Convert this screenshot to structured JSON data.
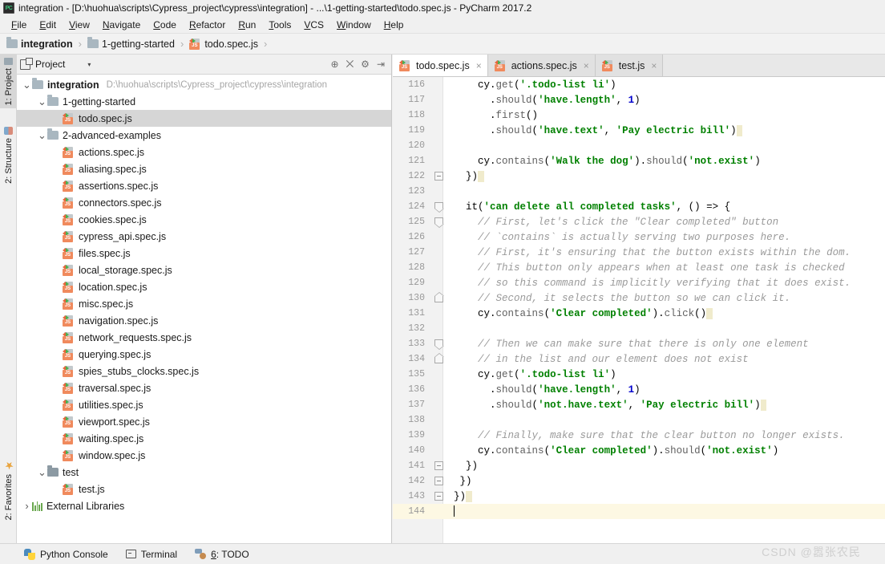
{
  "window": {
    "title": "integration - [D:\\huohua\\scripts\\Cypress_project\\cypress\\integration] - ...\\1-getting-started\\todo.spec.js - PyCharm 2017.2",
    "app_logo": "PC"
  },
  "menubar": {
    "items": [
      {
        "label": "File"
      },
      {
        "label": "Edit"
      },
      {
        "label": "View"
      },
      {
        "label": "Navigate"
      },
      {
        "label": "Code"
      },
      {
        "label": "Refactor"
      },
      {
        "label": "Run"
      },
      {
        "label": "Tools"
      },
      {
        "label": "VCS"
      },
      {
        "label": "Window"
      },
      {
        "label": "Help"
      }
    ]
  },
  "breadcrumb": {
    "items": [
      {
        "label": "integration",
        "icon": "folder-icon"
      },
      {
        "label": "1-getting-started",
        "icon": "folder-icon"
      },
      {
        "label": "todo.spec.js",
        "icon": "js-test-file-icon"
      }
    ],
    "separator": "›"
  },
  "left_strip": {
    "tabs": [
      {
        "label": "1: Project",
        "selected": true,
        "icon": "project-icon"
      },
      {
        "label": "2: Structure",
        "selected": false,
        "icon": "structure-icon"
      },
      {
        "label": "2: Favorites",
        "selected": false,
        "icon": "star-icon"
      }
    ]
  },
  "project_panel": {
    "header": {
      "title": "Project",
      "dropdown_caret": "▾",
      "tools": [
        {
          "name": "locate-icon",
          "glyph": "⊕"
        },
        {
          "name": "expand-collapse-icon",
          "glyph": "⨉"
        },
        {
          "name": "settings-gear-icon",
          "glyph": "⚙"
        },
        {
          "name": "hide-panel-icon",
          "glyph": "⇥"
        }
      ]
    },
    "tree": [
      {
        "label": "integration",
        "path": "D:\\huohua\\scripts\\Cypress_project\\cypress\\integration",
        "indent": 0,
        "twisty": "⌄",
        "icon": "folder-icon",
        "bold": true,
        "selected": false
      },
      {
        "label": "1-getting-started",
        "path": "",
        "indent": 1,
        "twisty": "⌄",
        "icon": "folder-icon",
        "bold": false,
        "selected": false
      },
      {
        "label": "todo.spec.js",
        "path": "",
        "indent": 2,
        "twisty": "",
        "icon": "js-test-file-icon",
        "bold": false,
        "selected": true
      },
      {
        "label": "2-advanced-examples",
        "path": "",
        "indent": 1,
        "twisty": "⌄",
        "icon": "folder-icon",
        "bold": false,
        "selected": false
      },
      {
        "label": "actions.spec.js",
        "path": "",
        "indent": 2,
        "twisty": "",
        "icon": "js-test-file-icon",
        "bold": false,
        "selected": false
      },
      {
        "label": "aliasing.spec.js",
        "path": "",
        "indent": 2,
        "twisty": "",
        "icon": "js-test-file-icon",
        "bold": false,
        "selected": false
      },
      {
        "label": "assertions.spec.js",
        "path": "",
        "indent": 2,
        "twisty": "",
        "icon": "js-test-file-icon",
        "bold": false,
        "selected": false
      },
      {
        "label": "connectors.spec.js",
        "path": "",
        "indent": 2,
        "twisty": "",
        "icon": "js-test-file-icon",
        "bold": false,
        "selected": false
      },
      {
        "label": "cookies.spec.js",
        "path": "",
        "indent": 2,
        "twisty": "",
        "icon": "js-test-file-icon",
        "bold": false,
        "selected": false
      },
      {
        "label": "cypress_api.spec.js",
        "path": "",
        "indent": 2,
        "twisty": "",
        "icon": "js-test-file-icon",
        "bold": false,
        "selected": false
      },
      {
        "label": "files.spec.js",
        "path": "",
        "indent": 2,
        "twisty": "",
        "icon": "js-test-file-icon",
        "bold": false,
        "selected": false
      },
      {
        "label": "local_storage.spec.js",
        "path": "",
        "indent": 2,
        "twisty": "",
        "icon": "js-test-file-icon",
        "bold": false,
        "selected": false
      },
      {
        "label": "location.spec.js",
        "path": "",
        "indent": 2,
        "twisty": "",
        "icon": "js-test-file-icon",
        "bold": false,
        "selected": false
      },
      {
        "label": "misc.spec.js",
        "path": "",
        "indent": 2,
        "twisty": "",
        "icon": "js-test-file-icon",
        "bold": false,
        "selected": false
      },
      {
        "label": "navigation.spec.js",
        "path": "",
        "indent": 2,
        "twisty": "",
        "icon": "js-test-file-icon",
        "bold": false,
        "selected": false
      },
      {
        "label": "network_requests.spec.js",
        "path": "",
        "indent": 2,
        "twisty": "",
        "icon": "js-test-file-icon",
        "bold": false,
        "selected": false
      },
      {
        "label": "querying.spec.js",
        "path": "",
        "indent": 2,
        "twisty": "",
        "icon": "js-test-file-icon",
        "bold": false,
        "selected": false
      },
      {
        "label": "spies_stubs_clocks.spec.js",
        "path": "",
        "indent": 2,
        "twisty": "",
        "icon": "js-test-file-icon",
        "bold": false,
        "selected": false
      },
      {
        "label": "traversal.spec.js",
        "path": "",
        "indent": 2,
        "twisty": "",
        "icon": "js-test-file-icon",
        "bold": false,
        "selected": false
      },
      {
        "label": "utilities.spec.js",
        "path": "",
        "indent": 2,
        "twisty": "",
        "icon": "js-test-file-icon",
        "bold": false,
        "selected": false
      },
      {
        "label": "viewport.spec.js",
        "path": "",
        "indent": 2,
        "twisty": "",
        "icon": "js-test-file-icon",
        "bold": false,
        "selected": false
      },
      {
        "label": "waiting.spec.js",
        "path": "",
        "indent": 2,
        "twisty": "",
        "icon": "js-test-file-icon",
        "bold": false,
        "selected": false
      },
      {
        "label": "window.spec.js",
        "path": "",
        "indent": 2,
        "twisty": "",
        "icon": "js-test-file-icon",
        "bold": false,
        "selected": false
      },
      {
        "label": "test",
        "path": "",
        "indent": 1,
        "twisty": "⌄",
        "icon": "folder-icon-dark",
        "bold": false,
        "selected": false
      },
      {
        "label": "test.js",
        "path": "",
        "indent": 2,
        "twisty": "",
        "icon": "js-test-file-icon",
        "bold": false,
        "selected": false
      },
      {
        "label": "External Libraries",
        "path": "",
        "indent": 0,
        "twisty": "›",
        "icon": "libraries-icon",
        "bold": false,
        "selected": false
      }
    ]
  },
  "editor": {
    "tabs": [
      {
        "label": "todo.spec.js",
        "active": true,
        "close": "×",
        "icon": "js-test-file-icon"
      },
      {
        "label": "actions.spec.js",
        "active": false,
        "close": "×",
        "icon": "js-test-file-icon"
      },
      {
        "label": "test.js",
        "active": false,
        "close": "×",
        "icon": "js-test-file-icon"
      }
    ],
    "first_line_number": 116,
    "current_line": 144,
    "lines": [
      {
        "n": 116,
        "fold": "",
        "tokens": [
          {
            "t": "    ",
            "c": "pl"
          },
          {
            "t": "cy",
            "c": "kw"
          },
          {
            "t": ".",
            "c": "kw"
          },
          {
            "t": "get",
            "c": "fn"
          },
          {
            "t": "(",
            "c": "kw"
          },
          {
            "t": "'.todo-list li'",
            "c": "str"
          },
          {
            "t": ")",
            "c": "kw"
          }
        ]
      },
      {
        "n": 117,
        "fold": "",
        "tokens": [
          {
            "t": "      ",
            "c": "pl"
          },
          {
            "t": ".",
            "c": "kw"
          },
          {
            "t": "should",
            "c": "fn"
          },
          {
            "t": "(",
            "c": "kw"
          },
          {
            "t": "'have.length'",
            "c": "str"
          },
          {
            "t": ", ",
            "c": "kw"
          },
          {
            "t": "1",
            "c": "num"
          },
          {
            "t": ")",
            "c": "kw"
          }
        ]
      },
      {
        "n": 118,
        "fold": "",
        "tokens": [
          {
            "t": "      ",
            "c": "pl"
          },
          {
            "t": ".",
            "c": "kw"
          },
          {
            "t": "first",
            "c": "fn"
          },
          {
            "t": "()",
            "c": "kw"
          }
        ]
      },
      {
        "n": 119,
        "fold": "",
        "tokens": [
          {
            "t": "      ",
            "c": "pl"
          },
          {
            "t": ".",
            "c": "kw"
          },
          {
            "t": "should",
            "c": "fn"
          },
          {
            "t": "(",
            "c": "kw"
          },
          {
            "t": "'have.text'",
            "c": "str"
          },
          {
            "t": ", ",
            "c": "kw"
          },
          {
            "t": "'Pay electric bill'",
            "c": "str"
          },
          {
            "t": ")",
            "c": "kw"
          },
          {
            "t": " ",
            "c": "hl"
          }
        ]
      },
      {
        "n": 120,
        "fold": "",
        "tokens": []
      },
      {
        "n": 121,
        "fold": "",
        "tokens": [
          {
            "t": "    ",
            "c": "pl"
          },
          {
            "t": "cy",
            "c": "kw"
          },
          {
            "t": ".",
            "c": "kw"
          },
          {
            "t": "contains",
            "c": "fn"
          },
          {
            "t": "(",
            "c": "kw"
          },
          {
            "t": "'Walk the dog'",
            "c": "str"
          },
          {
            "t": ")",
            "c": "kw"
          },
          {
            "t": ".",
            "c": "kw"
          },
          {
            "t": "should",
            "c": "fn"
          },
          {
            "t": "(",
            "c": "kw"
          },
          {
            "t": "'not.exist'",
            "c": "str"
          },
          {
            "t": ")",
            "c": "kw"
          }
        ]
      },
      {
        "n": 122,
        "fold": "flat",
        "tokens": [
          {
            "t": "  ",
            "c": "pl"
          },
          {
            "t": "})",
            "c": "kw"
          },
          {
            "t": " ",
            "c": "hl"
          }
        ]
      },
      {
        "n": 123,
        "fold": "",
        "tokens": []
      },
      {
        "n": 124,
        "fold": "down",
        "tokens": [
          {
            "t": "  ",
            "c": "pl"
          },
          {
            "t": "it",
            "c": "kw"
          },
          {
            "t": "(",
            "c": "kw"
          },
          {
            "t": "'can delete all completed tasks'",
            "c": "str"
          },
          {
            "t": ", () => {",
            "c": "kw"
          }
        ]
      },
      {
        "n": 125,
        "fold": "down",
        "tokens": [
          {
            "t": "    ",
            "c": "pl"
          },
          {
            "t": "// First, let's click the \"Clear completed\" button",
            "c": "cm"
          }
        ]
      },
      {
        "n": 126,
        "fold": "",
        "tokens": [
          {
            "t": "    ",
            "c": "pl"
          },
          {
            "t": "// `contains` is actually serving two purposes here.",
            "c": "cm"
          }
        ]
      },
      {
        "n": 127,
        "fold": "",
        "tokens": [
          {
            "t": "    ",
            "c": "pl"
          },
          {
            "t": "// First, it's ensuring that the button exists within the dom.",
            "c": "cm"
          }
        ]
      },
      {
        "n": 128,
        "fold": "",
        "tokens": [
          {
            "t": "    ",
            "c": "pl"
          },
          {
            "t": "// This button only appears when at least one task is checked",
            "c": "cm"
          }
        ]
      },
      {
        "n": 129,
        "fold": "",
        "tokens": [
          {
            "t": "    ",
            "c": "pl"
          },
          {
            "t": "// so this command is implicitly verifying that it does exist.",
            "c": "cm"
          }
        ]
      },
      {
        "n": 130,
        "fold": "up",
        "tokens": [
          {
            "t": "    ",
            "c": "pl"
          },
          {
            "t": "// Second, it selects the button so we can click it.",
            "c": "cm"
          }
        ]
      },
      {
        "n": 131,
        "fold": "",
        "tokens": [
          {
            "t": "    ",
            "c": "pl"
          },
          {
            "t": "cy",
            "c": "kw"
          },
          {
            "t": ".",
            "c": "kw"
          },
          {
            "t": "contains",
            "c": "fn"
          },
          {
            "t": "(",
            "c": "kw"
          },
          {
            "t": "'Clear completed'",
            "c": "str"
          },
          {
            "t": ")",
            "c": "kw"
          },
          {
            "t": ".",
            "c": "kw"
          },
          {
            "t": "click",
            "c": "fn"
          },
          {
            "t": "()",
            "c": "kw"
          },
          {
            "t": " ",
            "c": "hl"
          }
        ]
      },
      {
        "n": 132,
        "fold": "",
        "tokens": []
      },
      {
        "n": 133,
        "fold": "down",
        "tokens": [
          {
            "t": "    ",
            "c": "pl"
          },
          {
            "t": "// Then we can make sure that there is only one element",
            "c": "cm"
          }
        ]
      },
      {
        "n": 134,
        "fold": "up",
        "tokens": [
          {
            "t": "    ",
            "c": "pl"
          },
          {
            "t": "// in the list and our element does not exist",
            "c": "cm"
          }
        ]
      },
      {
        "n": 135,
        "fold": "",
        "tokens": [
          {
            "t": "    ",
            "c": "pl"
          },
          {
            "t": "cy",
            "c": "kw"
          },
          {
            "t": ".",
            "c": "kw"
          },
          {
            "t": "get",
            "c": "fn"
          },
          {
            "t": "(",
            "c": "kw"
          },
          {
            "t": "'.todo-list li'",
            "c": "str"
          },
          {
            "t": ")",
            "c": "kw"
          }
        ]
      },
      {
        "n": 136,
        "fold": "",
        "tokens": [
          {
            "t": "      ",
            "c": "pl"
          },
          {
            "t": ".",
            "c": "kw"
          },
          {
            "t": "should",
            "c": "fn"
          },
          {
            "t": "(",
            "c": "kw"
          },
          {
            "t": "'have.length'",
            "c": "str"
          },
          {
            "t": ", ",
            "c": "kw"
          },
          {
            "t": "1",
            "c": "num"
          },
          {
            "t": ")",
            "c": "kw"
          }
        ]
      },
      {
        "n": 137,
        "fold": "",
        "tokens": [
          {
            "t": "      ",
            "c": "pl"
          },
          {
            "t": ".",
            "c": "kw"
          },
          {
            "t": "should",
            "c": "fn"
          },
          {
            "t": "(",
            "c": "kw"
          },
          {
            "t": "'not.have.text'",
            "c": "str"
          },
          {
            "t": ", ",
            "c": "kw"
          },
          {
            "t": "'Pay electric bill'",
            "c": "str"
          },
          {
            "t": ")",
            "c": "kw"
          },
          {
            "t": " ",
            "c": "hl"
          }
        ]
      },
      {
        "n": 138,
        "fold": "",
        "tokens": []
      },
      {
        "n": 139,
        "fold": "",
        "tokens": [
          {
            "t": "    ",
            "c": "pl"
          },
          {
            "t": "// Finally, make sure that the clear button no longer exists.",
            "c": "cm"
          }
        ]
      },
      {
        "n": 140,
        "fold": "",
        "tokens": [
          {
            "t": "    ",
            "c": "pl"
          },
          {
            "t": "cy",
            "c": "kw"
          },
          {
            "t": ".",
            "c": "kw"
          },
          {
            "t": "contains",
            "c": "fn"
          },
          {
            "t": "(",
            "c": "kw"
          },
          {
            "t": "'Clear completed'",
            "c": "str"
          },
          {
            "t": ")",
            "c": "kw"
          },
          {
            "t": ".",
            "c": "kw"
          },
          {
            "t": "should",
            "c": "fn"
          },
          {
            "t": "(",
            "c": "kw"
          },
          {
            "t": "'not.exist'",
            "c": "str"
          },
          {
            "t": ")",
            "c": "kw"
          }
        ]
      },
      {
        "n": 141,
        "fold": "flat",
        "tokens": [
          {
            "t": "  ",
            "c": "pl"
          },
          {
            "t": "})",
            "c": "kw"
          }
        ]
      },
      {
        "n": 142,
        "fold": "flat",
        "tokens": [
          {
            "t": " ",
            "c": "pl"
          },
          {
            "t": "})",
            "c": "kw"
          }
        ]
      },
      {
        "n": 143,
        "fold": "flat",
        "tokens": [
          {
            "t": "",
            "c": "pl"
          },
          {
            "t": "})",
            "c": "kw"
          },
          {
            "t": " ",
            "c": "hl"
          }
        ]
      },
      {
        "n": 144,
        "fold": "",
        "tokens": [],
        "current": true,
        "caret": true
      }
    ]
  },
  "statusbar": {
    "items": [
      {
        "label": "Python Console",
        "icon": "python-icon",
        "underline": ""
      },
      {
        "label": "Terminal",
        "icon": "terminal-icon",
        "underline": ""
      },
      {
        "label": "6: TODO",
        "icon": "todo-icon",
        "underline": "6"
      }
    ]
  },
  "watermark": {
    "text": "CSDN @嚣张农民"
  },
  "colors": {
    "accent_orange": "#f08a5d",
    "string_green": "#008000",
    "comment_gray": "#9a9a9a",
    "number_blue": "#0000cc",
    "selection_gray": "#d6d6d6",
    "current_line_yellow": "#fdf8e3"
  }
}
